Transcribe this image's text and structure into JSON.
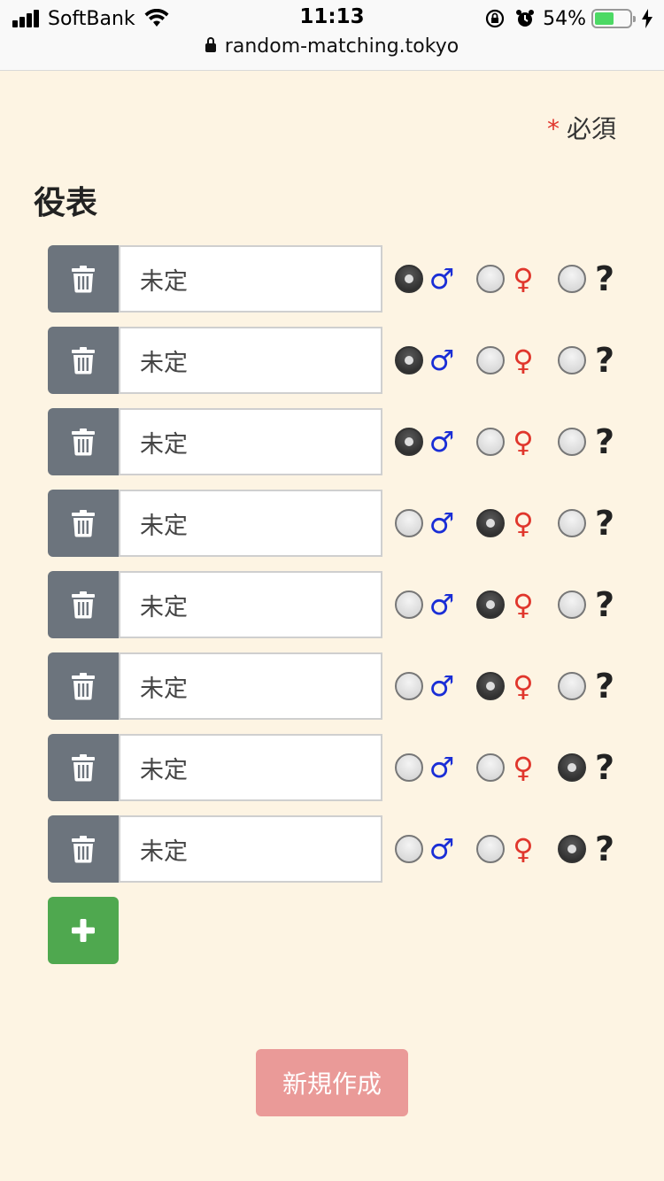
{
  "status_bar": {
    "carrier": "SoftBank",
    "time": "11:13",
    "battery_percent": "54%",
    "battery_level": 0.54,
    "url": "random-matching.tokyo"
  },
  "form": {
    "required_mark": "*",
    "required_label": "必須",
    "section_title": "役表",
    "gender_symbols": {
      "male": "♂",
      "female": "♀",
      "unknown": "?"
    },
    "rows": [
      {
        "name": "未定",
        "gender": "male"
      },
      {
        "name": "未定",
        "gender": "male"
      },
      {
        "name": "未定",
        "gender": "male"
      },
      {
        "name": "未定",
        "gender": "female"
      },
      {
        "name": "未定",
        "gender": "female"
      },
      {
        "name": "未定",
        "gender": "female"
      },
      {
        "name": "未定",
        "gender": "unknown"
      },
      {
        "name": "未定",
        "gender": "unknown"
      }
    ],
    "create_button_label": "新規作成"
  },
  "colors": {
    "background": "#fdf4e3",
    "delete_button": "#6c747d",
    "add_button": "#4fa84f",
    "create_button": "#ea9a98",
    "male": "#1a2ed6",
    "female": "#e0362c"
  },
  "icons": {
    "delete": "trash-icon",
    "add": "plus-icon"
  }
}
